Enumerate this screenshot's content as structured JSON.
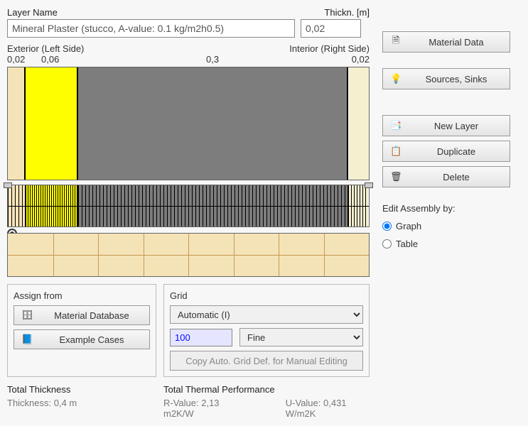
{
  "header": {
    "layerNameLabel": "Layer Name",
    "thicknessLabel": "Thickn. [m]",
    "layerNameValue": "Mineral Plaster (stucco, A-value: 0.1 kg/m2h0.5)",
    "thicknessValue": "0,02"
  },
  "canvas": {
    "exteriorLabel": "Exterior (Left Side)",
    "interiorLabel": "Interior (Right Side)",
    "ticks": {
      "t1": "0,02",
      "t2": "0,06",
      "t3": "0,3",
      "t4": "0,02"
    }
  },
  "assignPanel": {
    "title": "Assign from",
    "materialDb": "Material Database",
    "exampleCases": "Example Cases"
  },
  "gridPanel": {
    "title": "Grid",
    "mode": "Automatic (I)",
    "count": "100",
    "fineness": "Fine",
    "copyBtn": "Copy Auto. Grid Def. for Manual Editing"
  },
  "footer": {
    "totalThicknessLabel": "Total Thickness",
    "totalThicknessValue": "Thickness: 0,4 m",
    "thermalLabel": "Total Thermal Performance",
    "rvalue": "R-Value: 2,13 m2K/W",
    "uvalue": "U-Value: 0,431 W/m2K"
  },
  "sidebar": {
    "materialData": "Material Data",
    "sourcesSinks": "Sources, Sinks",
    "newLayer": "New Layer",
    "duplicate": "Duplicate",
    "delete": "Delete",
    "editByLabel": "Edit Assembly by:",
    "graph": "Graph",
    "table": "Table"
  },
  "icons": {
    "doc": "🗎",
    "bulb": "💡",
    "arrow": "↪",
    "newlayer": "📑",
    "dup": "📋",
    "del": "🗑",
    "db": "🗄",
    "case": "📘"
  }
}
